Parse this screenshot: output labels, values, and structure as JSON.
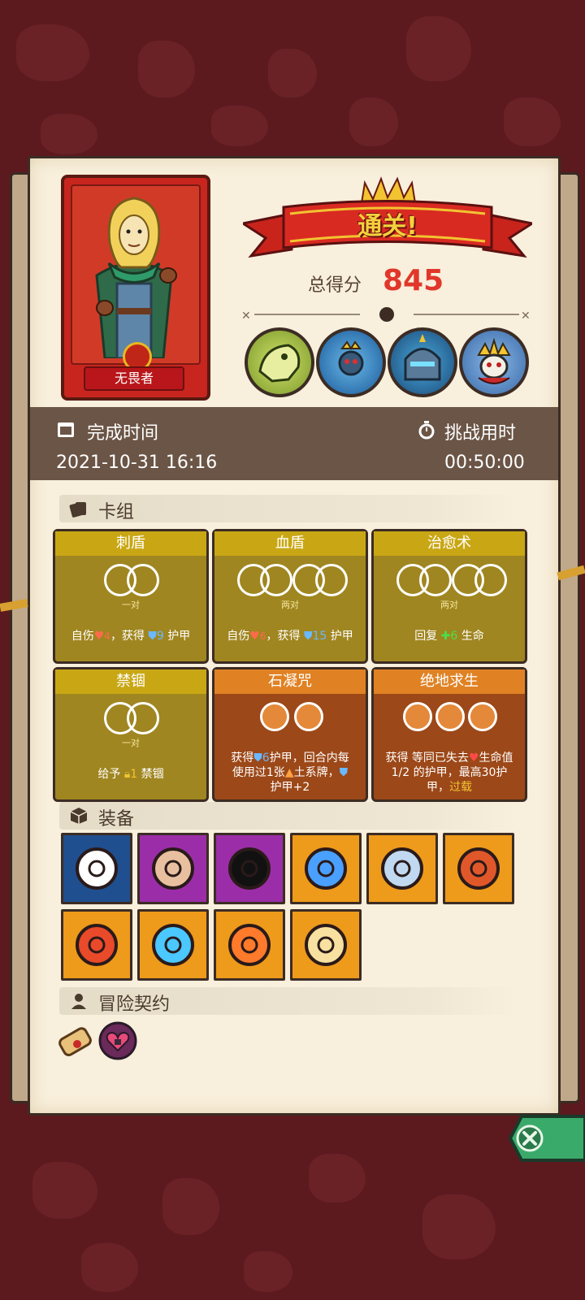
{
  "result": {
    "banner": "通关!",
    "score_label": "总得分",
    "score_value": "845"
  },
  "hero": {
    "name": "无畏者"
  },
  "bosses": [
    "bone-dragon-boss",
    "spider-queen-boss",
    "knight-helmet-boss",
    "skull-king-boss"
  ],
  "info": {
    "finish_time_label": "完成时间",
    "finish_time_value": "2021-10-31 16:16",
    "challenge_time_label": "挑战用时",
    "challenge_time_value": "00:50:00"
  },
  "deck": {
    "title": "卡组",
    "cards": [
      {
        "name": "刺盾",
        "count": "一对",
        "desc_pre": "自伤",
        "self_dmg": "4",
        "desc_mid": "，获得",
        "shield": "9",
        "desc_post": "护甲"
      },
      {
        "name": "血盾",
        "count": "两对",
        "desc_pre": "自伤",
        "self_dmg": "6",
        "desc_mid": "，获得",
        "shield": "15",
        "desc_post": "护甲"
      },
      {
        "name": "治愈术",
        "count": "两对",
        "desc_pre": "回复",
        "heal": "6",
        "desc_post": "生命"
      },
      {
        "name": "禁锢",
        "count": "一对",
        "desc_pre": "给予",
        "lock": "1",
        "desc_post": "禁锢"
      },
      {
        "name": "石凝咒",
        "line1_pre": "获得",
        "line1_shield": "6",
        "line1_post": "护甲，回合内每",
        "line2": "使用过1张",
        "line2_post": "土系牌，",
        "line3": "护甲+2"
      },
      {
        "name": "绝地求生",
        "line1_pre": "获得 等同已失去",
        "line1_post": "生命值",
        "line2": "1/2 的护甲，最高30护",
        "line3_pre": "甲，",
        "line3_key": "过载"
      }
    ]
  },
  "equipment": {
    "title": "装备",
    "items": [
      {
        "icon": "horned-skull-mask-icon",
        "bg": "#1f4f8f"
      },
      {
        "icon": "wooden-button-shield-icon",
        "bg": "#9b2ea8"
      },
      {
        "icon": "cracked-rune-icon",
        "bg": "#9b2ea8"
      },
      {
        "icon": "blue-slime-icon",
        "bg": "#ee9a1a"
      },
      {
        "icon": "horn-cornucopia-icon",
        "bg": "#ee9a1a"
      },
      {
        "icon": "lava-ring-icon",
        "bg": "#ee9a1a"
      },
      {
        "icon": "tribal-mask-icon",
        "bg": "#ee9a1a"
      },
      {
        "icon": "ice-gem-amulet-icon",
        "bg": "#ee9a1a"
      },
      {
        "icon": "fire-feather-icon",
        "bg": "#ee9a1a"
      },
      {
        "icon": "golden-shield-icon",
        "bg": "#ee9a1a"
      }
    ]
  },
  "contracts": {
    "title": "冒险契约",
    "items": [
      "scroll-icon",
      "locked-heart-icon"
    ]
  }
}
